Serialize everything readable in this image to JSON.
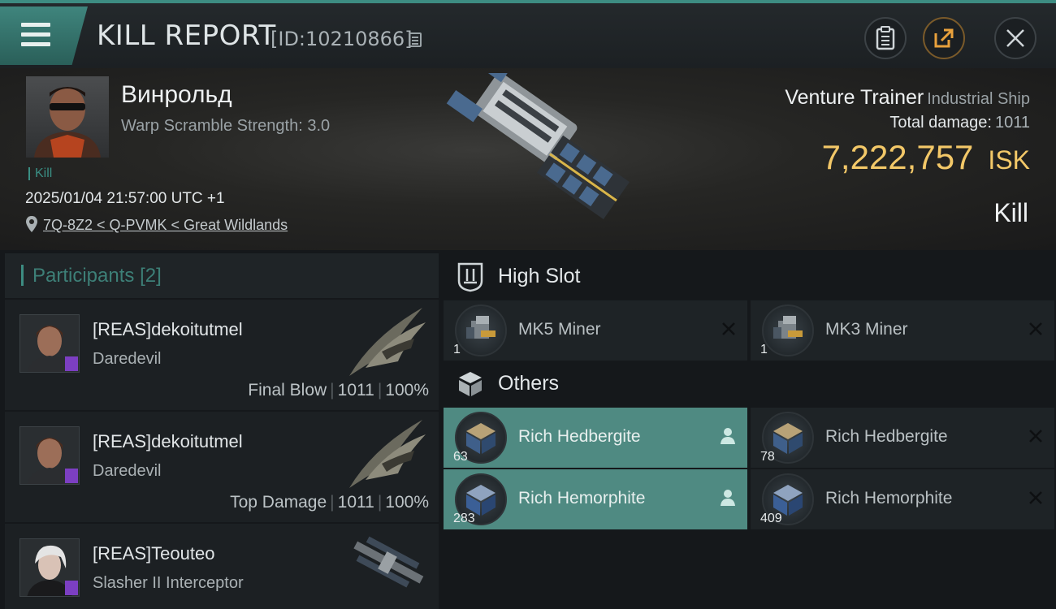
{
  "header": {
    "title": "KILL REPORT",
    "id_text": "[ID:10210866]"
  },
  "victim": {
    "pilot_name": "Винрольд",
    "scramble_text": "Warp Scramble Strength: 3.0",
    "kill_tag": "Kill",
    "datetime": "2025/01/04 21:57:00 UTC +1",
    "location": "7Q-8Z2 < Q-PVMK < Great Wildlands",
    "ship_name": "Venture Trainer",
    "ship_class": "Industrial Ship",
    "total_damage_label": "Total damage:",
    "total_damage_value": "1011",
    "isk_value": "7,222,757",
    "isk_unit": "ISK",
    "result": "Kill"
  },
  "participants": {
    "title": "Participants",
    "count": "[2]",
    "rows": [
      {
        "name": "[REAS]dekoitutmel",
        "ship": "Daredevil",
        "role": "Final Blow",
        "damage": "1011",
        "percent": "100%"
      },
      {
        "name": "[REAS]dekoitutmel",
        "ship": "Daredevil",
        "role": "Top Damage",
        "damage": "1011",
        "percent": "100%"
      },
      {
        "name": "[REAS]Teouteo",
        "ship": "Slasher II Interceptor"
      }
    ]
  },
  "high_slot": {
    "title": "High Slot",
    "items": [
      {
        "name": "MK5 Miner",
        "count": "1"
      },
      {
        "name": "MK3 Miner",
        "count": "1"
      }
    ]
  },
  "others": {
    "title": "Others",
    "items": [
      {
        "name": "Rich Hedbergite",
        "count": "63"
      },
      {
        "name": "Rich Hedbergite",
        "count": "78"
      },
      {
        "name": "Rich Hemorphite",
        "count": "283"
      },
      {
        "name": "Rich Hemorphite",
        "count": "409"
      }
    ]
  },
  "colors": {
    "accent": "#3d8c82",
    "isk": "#f3c868",
    "dropped": "#4f8a82"
  }
}
